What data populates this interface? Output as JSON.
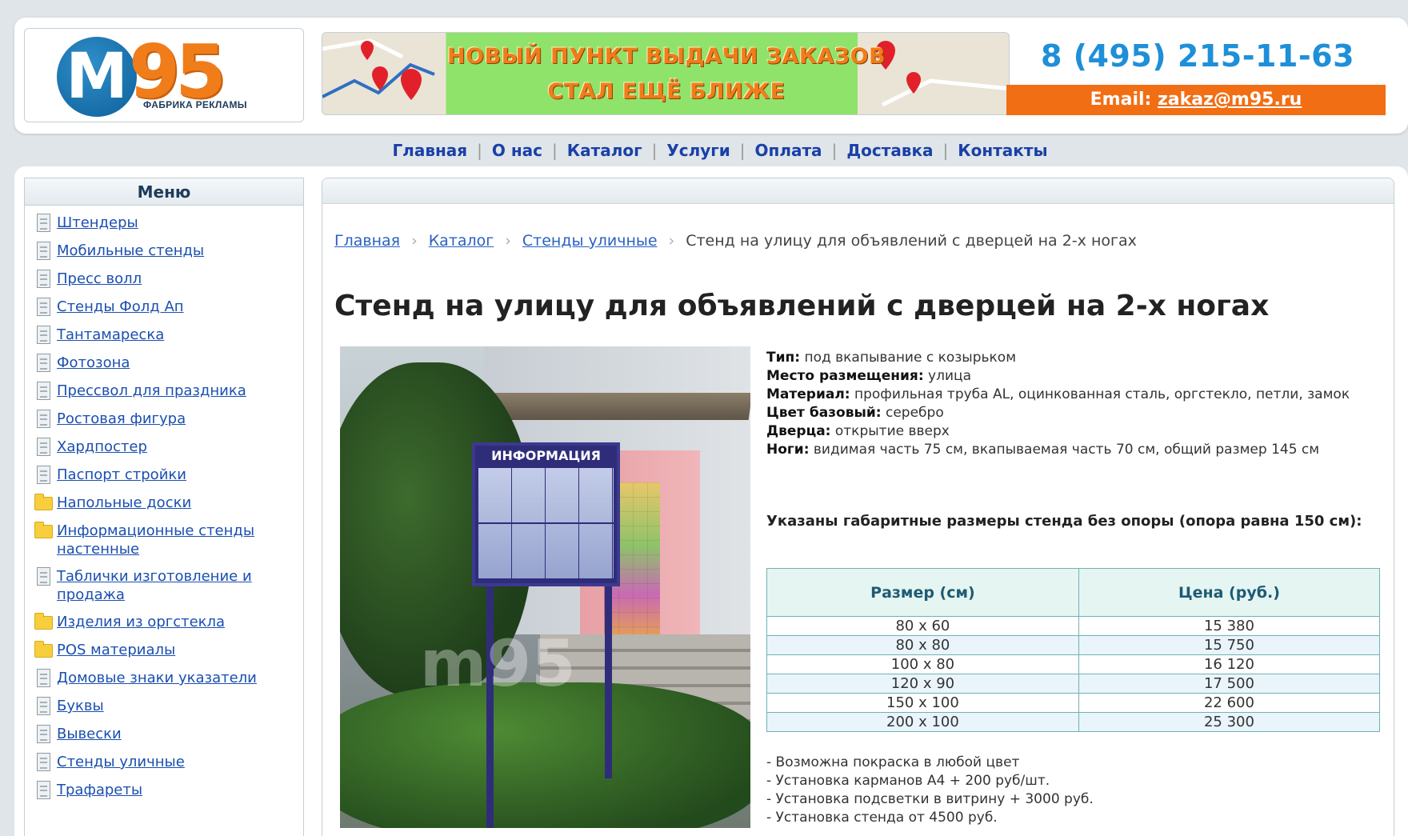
{
  "header": {
    "logo": {
      "letter": "M",
      "number": "95",
      "subtitle": "ФАБРИКА РЕКЛАМЫ"
    },
    "banner": {
      "line1": "НОВЫЙ ПУНКТ ВЫДАЧИ ЗАКАЗОВ",
      "line2": "СТАЛ ЕЩЁ БЛИЖЕ"
    },
    "phone": "8 (495) 215-11-63",
    "email_label": "Email:",
    "email": "zakaz@m95.ru",
    "colors": {
      "accent_orange": "#f26e14",
      "phone_blue": "#1f8fd8",
      "banner_green": "#8fe36a"
    }
  },
  "top_nav": [
    "Главная",
    "О нас",
    "Каталог",
    "Услуги",
    "Оплата",
    "Доставка",
    "Контакты"
  ],
  "sidebar": {
    "title": "Меню",
    "items": [
      {
        "label": "Штендеры",
        "icon": "document-icon"
      },
      {
        "label": "Мобильные стенды",
        "icon": "document-icon"
      },
      {
        "label": "Пресс волл",
        "icon": "document-icon"
      },
      {
        "label": "Стенды Фолд Ап",
        "icon": "document-icon"
      },
      {
        "label": "Тантамареска",
        "icon": "document-icon"
      },
      {
        "label": "Фотозона",
        "icon": "document-icon"
      },
      {
        "label": "Прессвол для праздника",
        "icon": "document-icon"
      },
      {
        "label": "Ростовая фигура",
        "icon": "document-icon"
      },
      {
        "label": "Хардпостер",
        "icon": "document-icon"
      },
      {
        "label": "Паспорт стройки",
        "icon": "document-icon"
      },
      {
        "label": "Напольные доски",
        "icon": "folder-icon"
      },
      {
        "label": "Информационные стенды настенные",
        "icon": "folder-icon"
      },
      {
        "label": "Таблички изготовление и продажа",
        "icon": "document-icon"
      },
      {
        "label": "Изделия из оргстекла",
        "icon": "folder-icon"
      },
      {
        "label": "POS материалы",
        "icon": "folder-icon"
      },
      {
        "label": "Домовые знаки указатели",
        "icon": "document-icon"
      },
      {
        "label": "Буквы",
        "icon": "document-icon"
      },
      {
        "label": "Вывески",
        "icon": "document-icon"
      },
      {
        "label": "Стенды уличные",
        "icon": "document-icon"
      },
      {
        "label": "Трафареты",
        "icon": "document-icon"
      }
    ]
  },
  "breadcrumb": [
    "Главная",
    "Каталог",
    "Стенды уличные",
    "Стенд на улицу для объявлений с дверцей на 2-х ногах"
  ],
  "product": {
    "title": "Стенд на улицу для объявлений с дверцей на 2-х ногах",
    "photo": {
      "stand_label": "ИНФОРМАЦИЯ",
      "watermark": "m95"
    },
    "specs": [
      {
        "key": "Тип:",
        "value": "под вкапывание с козырьком"
      },
      {
        "key": "Место размещения:",
        "value": "улица"
      },
      {
        "key": "Материал:",
        "value": "профильная труба AL, оцинкованная сталь, оргстекло, петли, замок"
      },
      {
        "key": "Цвет базовый:",
        "value": "серебро"
      },
      {
        "key": "Дверца:",
        "value": "открытие вверх"
      },
      {
        "key": "Ноги:",
        "value": "видимая часть 75 см, вкапываемая часть 70 см, общий размер 145 см"
      }
    ],
    "size_note": "Указаны габаритные размеры стенда без опоры (опора равна 150 см):",
    "table": {
      "headers": [
        "Размер (см)",
        "Цена (руб.)"
      ],
      "rows": [
        [
          "80 x 60",
          "15 380"
        ],
        [
          "80 x 80",
          "15 750"
        ],
        [
          "100 x 80",
          "16 120"
        ],
        [
          "120 x 90",
          "17 500"
        ],
        [
          "150 x 100",
          "22 600"
        ],
        [
          "200 x 100",
          "25 300"
        ]
      ]
    },
    "notes": [
      "- Возможна покраска в любой цвет",
      "- Установка карманов А4 + 200 руб/шт.",
      "- Установка подсветки в витрину + 3000 руб.",
      "- Установка стенда от 4500 руб."
    ]
  }
}
